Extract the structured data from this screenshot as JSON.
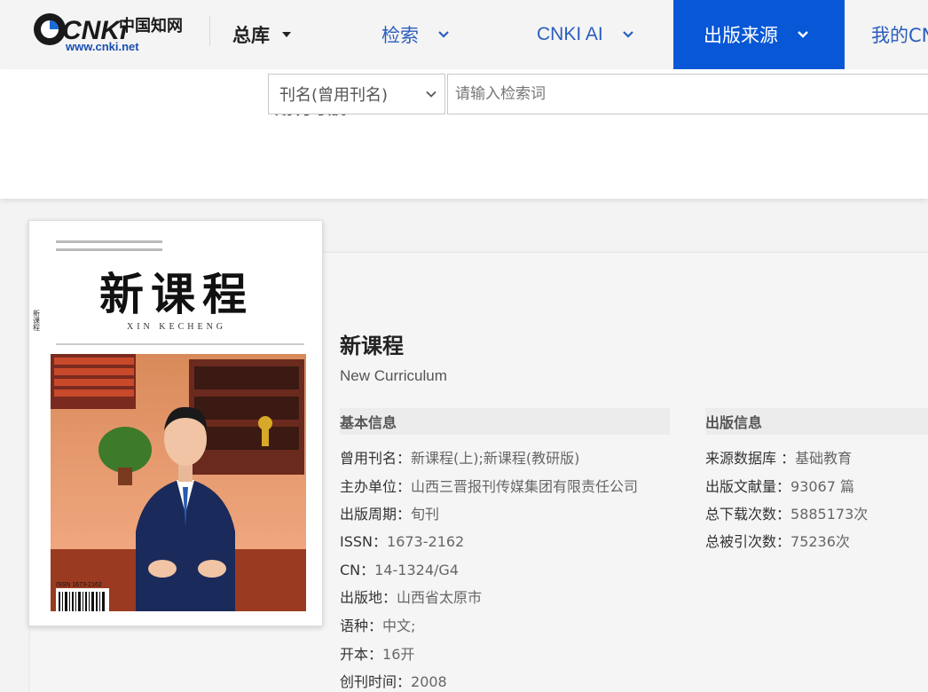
{
  "logo": {
    "brand": "CNKi",
    "cn_name": "中国知网",
    "url_text": "www.cnki.net"
  },
  "nav": {
    "zongku": "总库",
    "jiansuo": "检索",
    "cnki_ai": "CNKI AI",
    "source": "出版来源",
    "mine": "我的CN"
  },
  "search": {
    "journal_nav": "期刊导航",
    "field_select": "刊名(曾用刊名)",
    "placeholder": "请输入检索词"
  },
  "journal": {
    "title": "新课程",
    "en_title": "New Curriculum",
    "cover": {
      "cn_title": "新课程",
      "pinyin": "XIN KECHENG",
      "spine": "新课程",
      "issn": "ISSN 1673-2162"
    },
    "basic": {
      "heading": "基本信息",
      "rows": [
        {
          "label": "曾用刊名：",
          "value": "新课程(上);新课程(教研版)"
        },
        {
          "label": "主办单位：",
          "value": "山西三晋报刊传媒集团有限责任公司"
        },
        {
          "label": "出版周期：",
          "value": "旬刊"
        },
        {
          "label": "ISSN：",
          "value": "1673-2162"
        },
        {
          "label": "CN：",
          "value": "14-1324/G4"
        },
        {
          "label": "出版地：",
          "value": "山西省太原市"
        },
        {
          "label": "语种：",
          "value": "中文;"
        },
        {
          "label": "开本：",
          "value": "16开"
        },
        {
          "label": "创刊时间：",
          "value": "2008"
        }
      ]
    },
    "publication": {
      "heading": "出版信息",
      "rows": [
        {
          "label": "来源数据库 ：",
          "value": "基础教育"
        },
        {
          "label": "出版文献量：",
          "value": "93067 篇"
        },
        {
          "label": "总下载次数：",
          "value": "5885173次"
        },
        {
          "label": "总被引次数：",
          "value": "75236次"
        }
      ]
    }
  },
  "colors": {
    "accent": "#0757d6",
    "link": "#2a5dbd",
    "triangle": "#e9614f"
  }
}
